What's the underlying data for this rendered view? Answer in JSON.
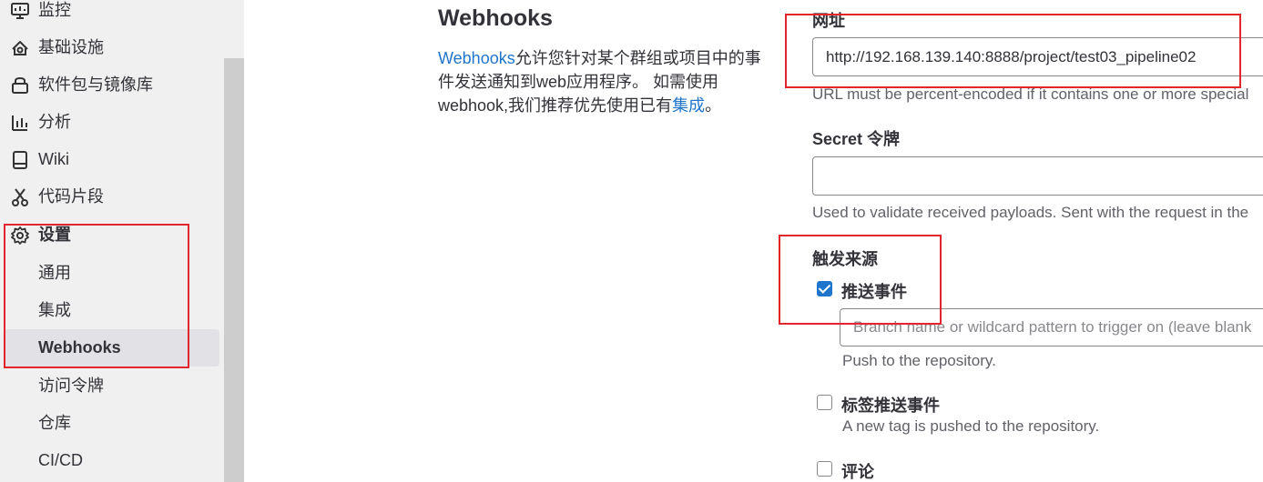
{
  "sidebar": {
    "items": [
      {
        "label": "监控",
        "icon": "monitor-icon"
      },
      {
        "label": "基础设施",
        "icon": "cloud-gear-icon"
      },
      {
        "label": "软件包与镜像库",
        "icon": "package-icon"
      },
      {
        "label": "分析",
        "icon": "chart-icon"
      },
      {
        "label": "Wiki",
        "icon": "book-icon"
      },
      {
        "label": "代码片段",
        "icon": "scissors-icon"
      },
      {
        "label": "设置",
        "icon": "settings-icon"
      }
    ],
    "settings_sub": [
      "通用",
      "集成",
      "Webhooks",
      "访问令牌",
      "仓库",
      "CI/CD"
    ]
  },
  "intro": {
    "title": "Webhooks",
    "text_link": "Webhooks",
    "text_part1": "允许您针对某个群组或项目中的事件发送通知到web应用程序。 如需使用webhook,我们推荐优先使用已有",
    "text_link2": "集成",
    "text_end": "。"
  },
  "form": {
    "url_label": "网址",
    "url_value": "http://192.168.139.140:8888/project/test03_pipeline02",
    "url_help": "URL must be percent-encoded if it contains one or more special",
    "secret_label": "Secret 令牌",
    "secret_value": "",
    "secret_help": "Used to validate received payloads. Sent with the request in the",
    "trigger_label": "触发来源",
    "push_label": "推送事件",
    "push_checked": true,
    "branch_placeholder": "Branch name or wildcard pattern to trigger on (leave blank",
    "push_help": "Push to the repository.",
    "tag_label": "标签推送事件",
    "tag_checked": false,
    "tag_help": "A new tag is pushed to the repository.",
    "comment_label": "评论",
    "comment_checked": false
  },
  "colors": {
    "accent": "#1f75cb",
    "highlight": "#e3262e",
    "sidebar_bg": "#f0f0f0"
  }
}
